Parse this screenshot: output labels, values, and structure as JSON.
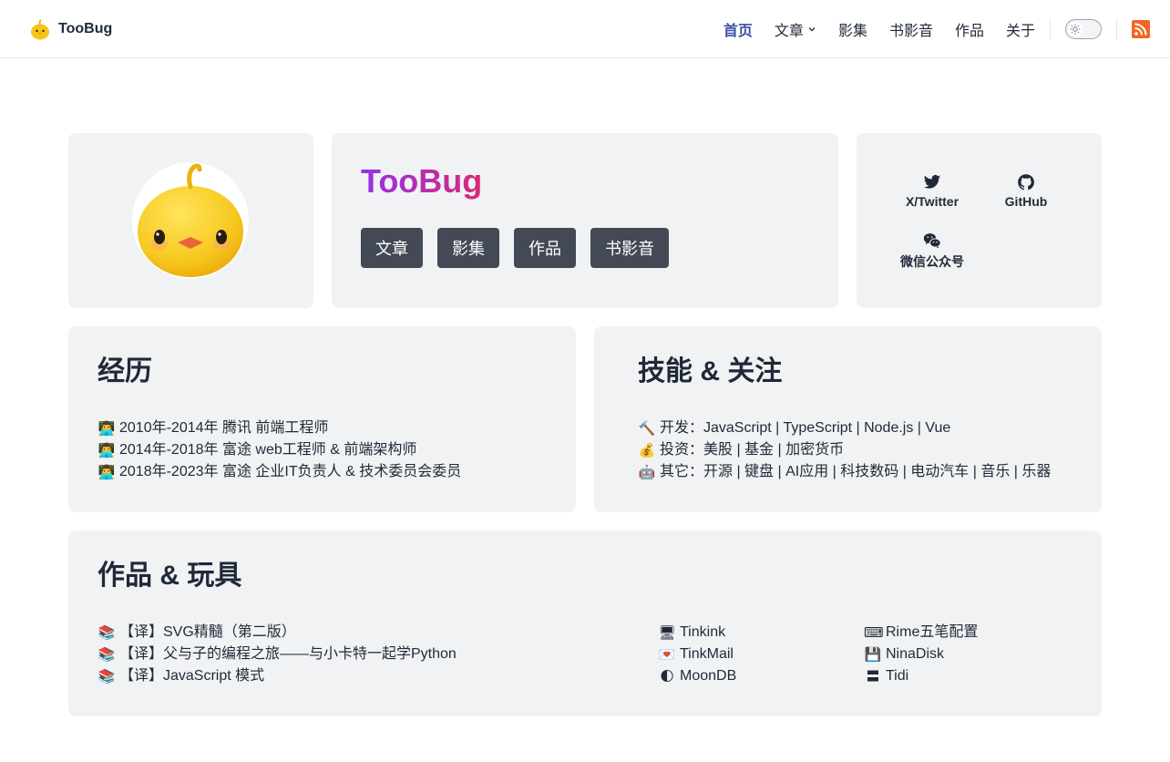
{
  "header": {
    "brand": "TooBug",
    "nav": [
      {
        "label": "首页",
        "active": true
      },
      {
        "label": "文章",
        "dropdown": true
      },
      {
        "label": "影集"
      },
      {
        "label": "书影音"
      },
      {
        "label": "作品"
      },
      {
        "label": "关于"
      }
    ],
    "theme_toggle_icon": "sun-icon",
    "rss_icon": "rss-icon"
  },
  "intro": {
    "name": "TooBug",
    "buttons": [
      "文章",
      "影集",
      "作品",
      "书影音"
    ]
  },
  "social": [
    {
      "label": "X/Twitter",
      "icon": "twitter-icon"
    },
    {
      "label": "GitHub",
      "icon": "github-icon"
    },
    {
      "label": "微信公众号",
      "icon": "wechat-icon"
    }
  ],
  "experience": {
    "title": "经历",
    "items": [
      {
        "emoji": "👨‍💻",
        "text": "2010年-2014年 腾讯 前端工程师"
      },
      {
        "emoji": "👨‍💻",
        "text": "2014年-2018年 富途 web工程师 & 前端架构师"
      },
      {
        "emoji": "👨‍💻",
        "text": "2018年-2023年 富途 企业IT负责人 & 技术委员会委员"
      }
    ]
  },
  "skills": {
    "title": "技能 & 关注",
    "items": [
      {
        "emoji": "🔨",
        "text": "开发：JavaScript | TypeScript | Node.js | Vue"
      },
      {
        "emoji": "💰",
        "text": "投资：美股 | 基金 | 加密货币"
      },
      {
        "emoji": "🤖",
        "text": "其它：开源 | 键盘 | AI应用 | 科技数码 | 电动汽车 | 音乐 | 乐器"
      }
    ]
  },
  "works": {
    "title": "作品 & 玩具",
    "books": [
      {
        "emoji": "📚",
        "text": "【译】SVG精髓（第二版）"
      },
      {
        "emoji": "📚",
        "text": "【译】父与子的编程之旅——与小卡特一起学Python"
      },
      {
        "emoji": "📚",
        "text": "【译】JavaScript 模式"
      }
    ],
    "apps_col1": [
      {
        "emoji": "🖥",
        "text": "Tinkink"
      },
      {
        "emoji": "💌",
        "text": "TinkMail"
      },
      {
        "emoji": "🌓",
        "text": "MoonDB"
      }
    ],
    "apps_col2": [
      {
        "emoji": "⌨",
        "text": "Rime五笔配置"
      },
      {
        "emoji": "💾",
        "text": "NinaDisk"
      },
      {
        "emoji": "〓",
        "text": "Tidi"
      }
    ]
  },
  "colors": {
    "nav_active": "#3c4fa3",
    "card_bg": "#f1f2f4",
    "button_bg": "#434a55",
    "name_gradient_start": "#9333ea",
    "name_gradient_end": "#db2777",
    "rss": "#f26522"
  }
}
